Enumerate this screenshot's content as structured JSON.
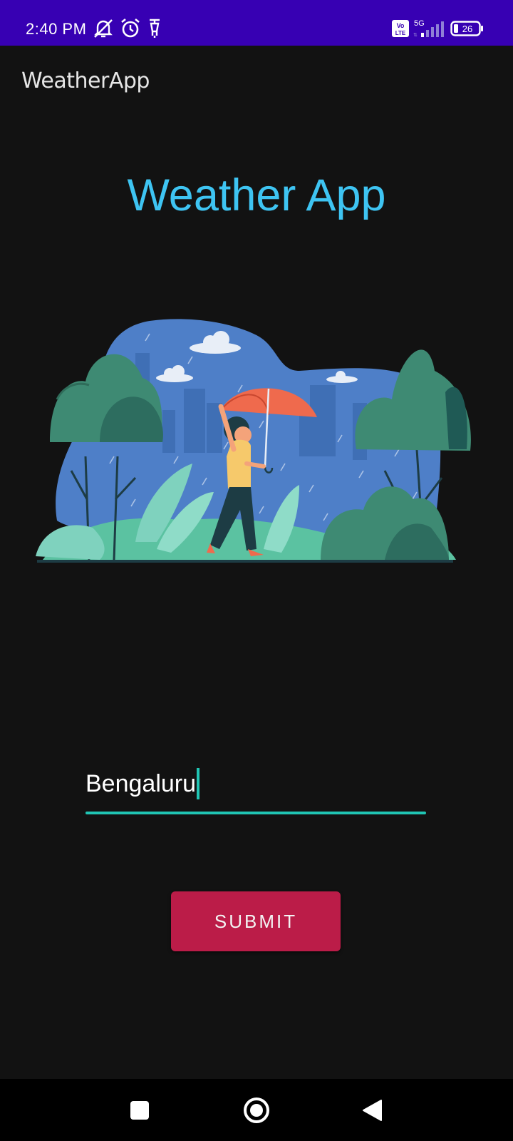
{
  "status_bar": {
    "time": "2:40 PM",
    "icons": [
      "mute-notifications-icon",
      "alarm-icon",
      "scooter-icon",
      "volte-icon",
      "5g-signal-icon",
      "battery-icon"
    ],
    "network": "5G",
    "volte": "Vo LTE",
    "battery_level": "26"
  },
  "app_bar": {
    "title": "WeatherApp"
  },
  "main": {
    "heading": "Weather App",
    "illustration": "girl-with-umbrella-in-rain",
    "city_input": {
      "value": "Bengaluru"
    },
    "submit_label": "SUBMIT"
  },
  "nav_bar": {
    "buttons": [
      "recent-apps",
      "home",
      "back"
    ]
  },
  "colors": {
    "status_bar": "#3700b3",
    "background": "#121212",
    "heading": "#3ec4f2",
    "accent": "#20c5b4",
    "button": "#bb1c48"
  }
}
